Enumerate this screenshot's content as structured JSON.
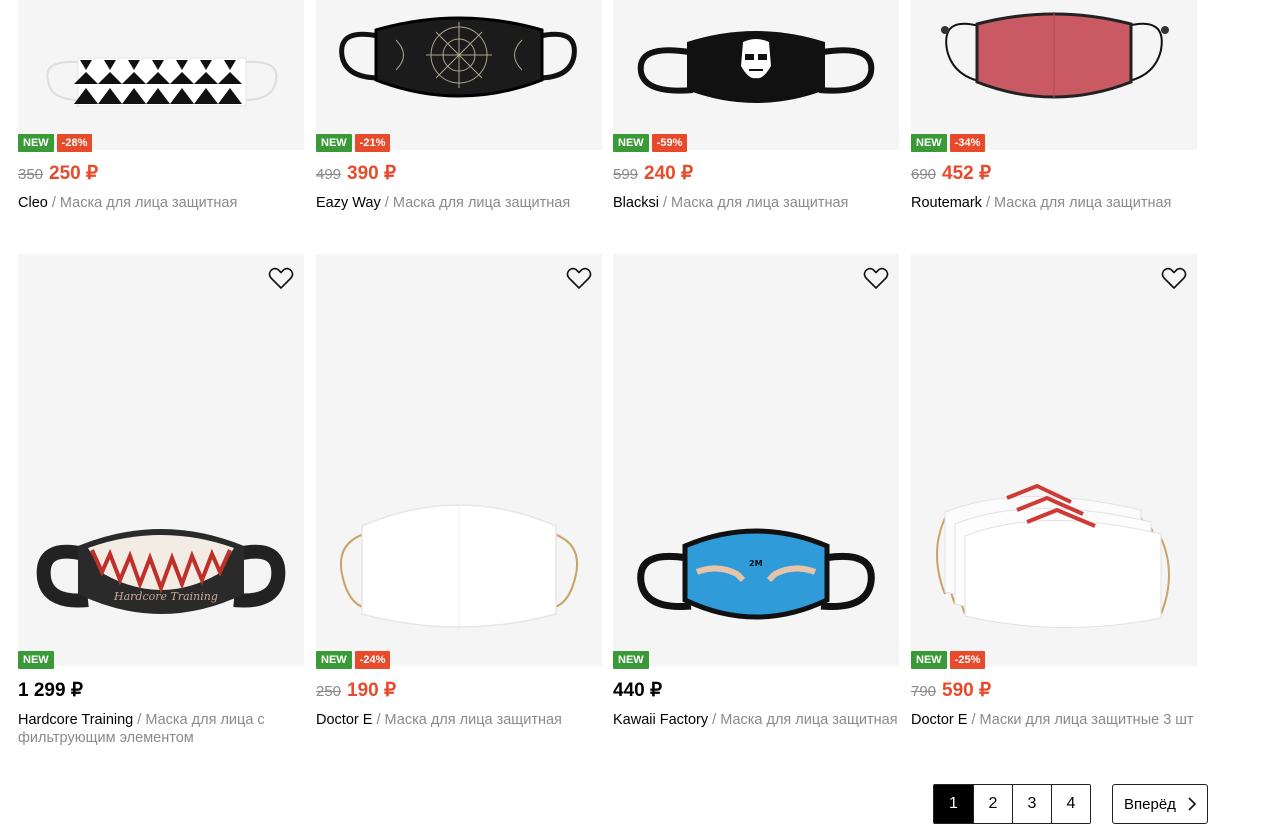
{
  "products_top": [
    {
      "badges": [
        "NEW",
        "-28%"
      ],
      "old_price": "350",
      "price": "250 ₽",
      "brand": "Cleo",
      "type": "Маска для лица защитная"
    },
    {
      "badges": [
        "NEW",
        "-21%"
      ],
      "old_price": "499",
      "price": "390 ₽",
      "brand": "Eazy Way",
      "type": "Маска для лица защитная"
    },
    {
      "badges": [
        "NEW",
        "-59%"
      ],
      "old_price": "599",
      "price": "240 ₽",
      "brand": "Blacksi",
      "type": "Маска для лица защитная"
    },
    {
      "badges": [
        "NEW",
        "-34%"
      ],
      "old_price": "690",
      "price": "452 ₽",
      "brand": "Routemark",
      "type": "Маска для лица защитная"
    }
  ],
  "products_bottom": [
    {
      "badges": [
        "NEW"
      ],
      "old_price": "",
      "price": "1 299 ₽",
      "brand": "Hardcore Training",
      "type": "Маска для лица с фильтрующим элементом"
    },
    {
      "badges": [
        "NEW",
        "-24%"
      ],
      "old_price": "250",
      "price": "190 ₽",
      "brand": "Doctor E",
      "type": "Маска для лица защитная"
    },
    {
      "badges": [
        "NEW"
      ],
      "old_price": "",
      "price": "440 ₽",
      "brand": "Kawaii Factory",
      "type": "Маска для лица защитная"
    },
    {
      "badges": [
        "NEW",
        "-25%"
      ],
      "old_price": "790",
      "price": "590 ₽",
      "brand": "Doctor E",
      "type": "Маски для лица защитные 3 шт"
    }
  ],
  "separator": "/",
  "pagination": {
    "pages": [
      "1",
      "2",
      "3",
      "4"
    ],
    "current": "1",
    "next_label": "Вперёд"
  },
  "colors": {
    "new_badge": "#3a9a38",
    "sale_badge": "#e84a2c",
    "sale_price": "#e84a2c",
    "muted": "#8a8a8a"
  },
  "icons": {
    "favorite": "heart-outline-icon",
    "next": "chevron-right-icon"
  }
}
